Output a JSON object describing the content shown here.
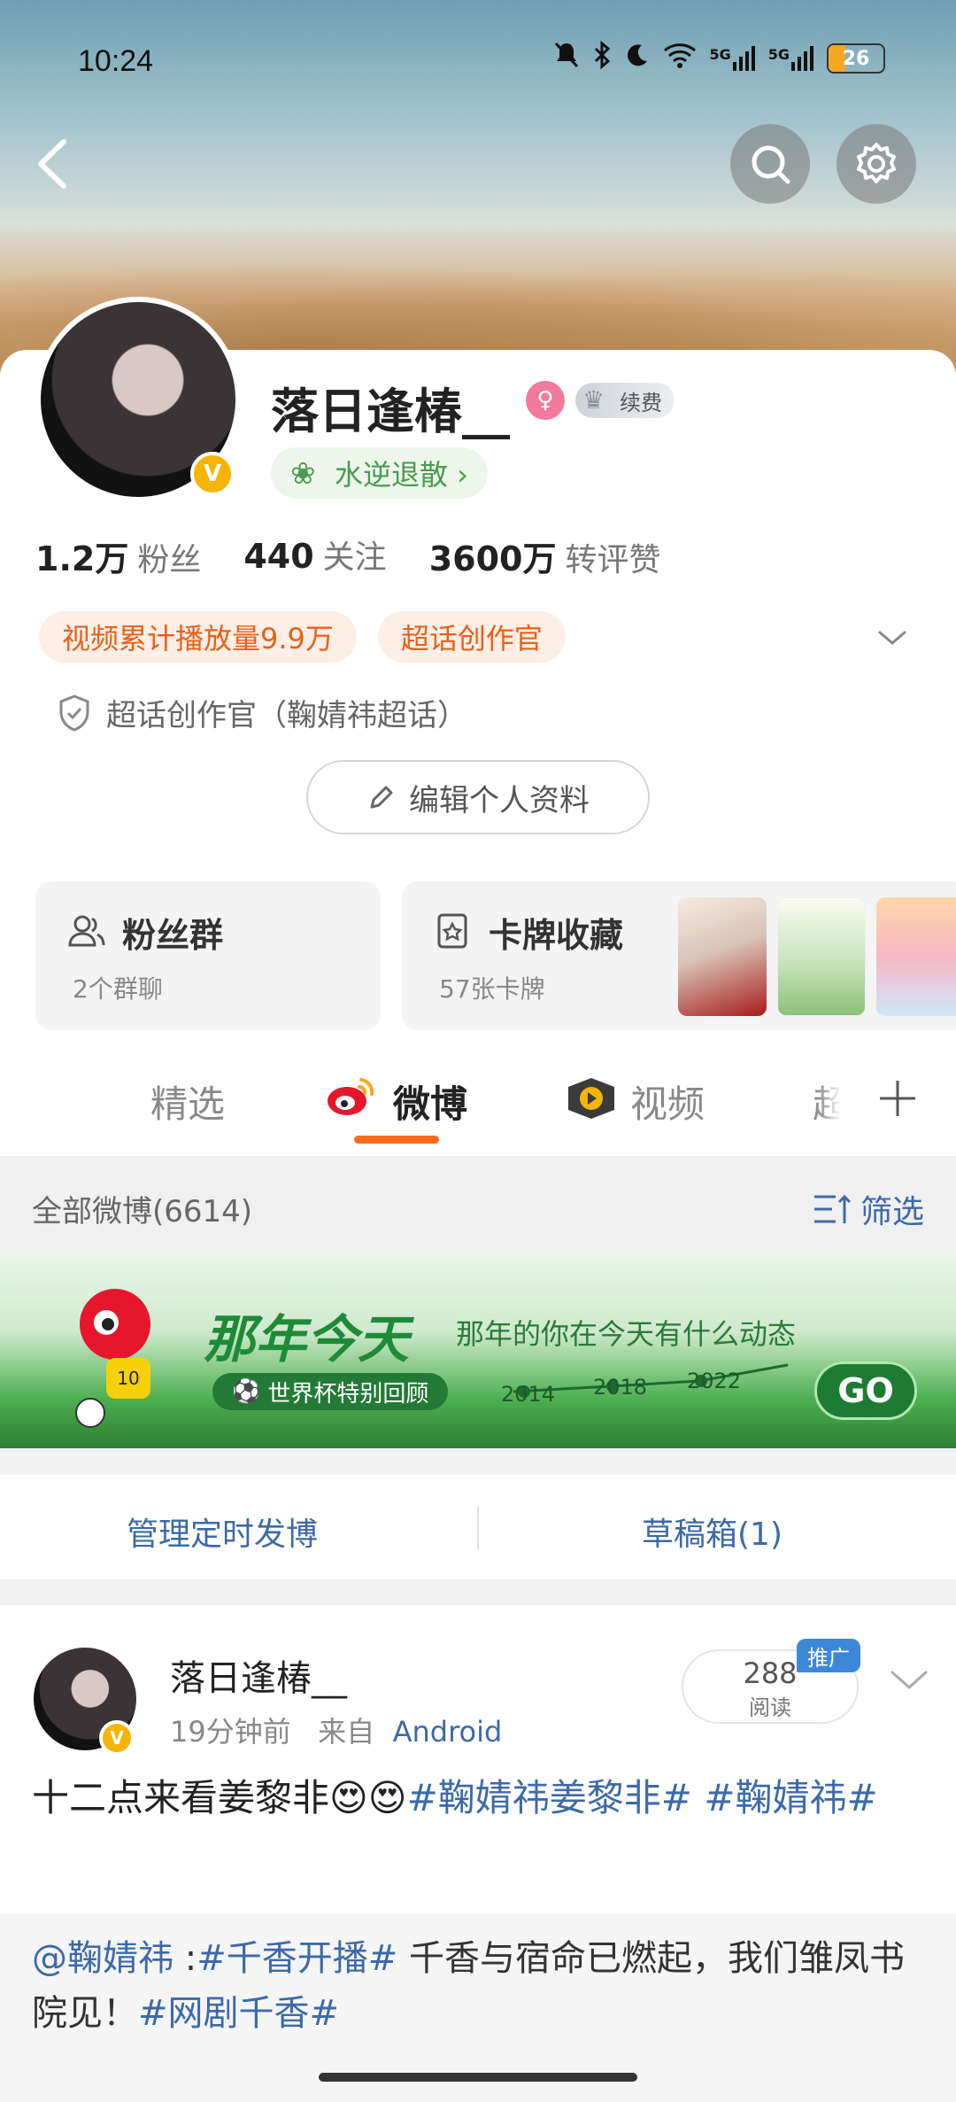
{
  "status_bar": {
    "time": "10:24",
    "battery": "26",
    "signal_a": "5G",
    "signal_b": "5G"
  },
  "profile": {
    "username": "落日逢椿__",
    "vip_label": "续费",
    "level_label": "水逆退散 ›",
    "stats": [
      {
        "value": "1.2万",
        "label": "粉丝"
      },
      {
        "value": "440",
        "label": "关注"
      },
      {
        "value": "3600万",
        "label": "转评赞"
      }
    ],
    "pills": [
      "视频累计播放量9.9万",
      "超话创作官"
    ],
    "creator_line": "超话创作官（鞠婧祎超话）",
    "edit_button": "编辑个人资料"
  },
  "boxes": {
    "fan_group": {
      "title": "粉丝群",
      "sub": "2个群聊"
    },
    "card_collection": {
      "title": "卡牌收藏",
      "sub": "57张卡牌"
    }
  },
  "tabs": {
    "items": [
      "精选",
      "微博",
      "视频",
      "超"
    ],
    "active_index": 1
  },
  "filter": {
    "title": "全部微博(6614)",
    "button": "筛选"
  },
  "promo": {
    "title": "那年今天",
    "subtitle": "那年的你在今天有什么动态",
    "chip": "世界杯特别回顾",
    "years": [
      "2014",
      "2018",
      "2022"
    ],
    "go": "GO",
    "mascot_number": "10"
  },
  "manage": {
    "scheduled": "管理定时发博",
    "drafts": "草稿箱(1)"
  },
  "post": {
    "name": "落日逢椿__",
    "time": "19分钟前",
    "from_label": "来自",
    "source": "Android",
    "read_count": "288",
    "read_label": "阅读",
    "promo_badge": "推广",
    "text_plain": "十二点来看姜黎非",
    "emoji": "😍😍",
    "topic1": "#鞠婧祎姜黎非#",
    "topic2": "#鞠婧祎#",
    "repost_mention": "@鞠婧祎",
    "repost_colon": " :",
    "repost_topic1": "#千香开播#",
    "repost_text": " 千香与宿命已燃起，我们雏凤书院见！",
    "repost_topic2": "#网剧千香#"
  },
  "colors": {
    "accent_orange": "#ff6a1a",
    "link_blue": "#3d6aa7",
    "pill_bg": "#fdeee6",
    "pill_text": "#e8611a",
    "vip_gold": "#f6b500"
  }
}
